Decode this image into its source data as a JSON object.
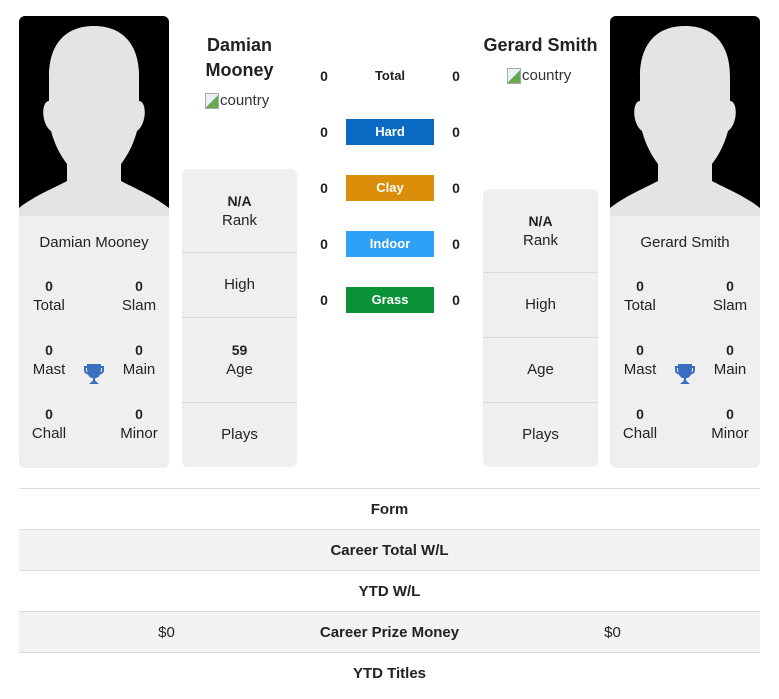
{
  "player1": {
    "name": "Damian Mooney",
    "name_line1": "Damian",
    "name_line2": "Mooney",
    "country_alt": "country",
    "titles": {
      "total": {
        "value": "0",
        "label": "Total"
      },
      "slam": {
        "value": "0",
        "label": "Slam"
      },
      "mast": {
        "value": "0",
        "label": "Mast"
      },
      "main": {
        "value": "0",
        "label": "Main"
      },
      "chall": {
        "value": "0",
        "label": "Chall"
      },
      "minor": {
        "value": "0",
        "label": "Minor"
      }
    },
    "info": {
      "rank_value": "N/A",
      "rank_label": "Rank",
      "high_label": "High",
      "age_value": "59",
      "age_label": "Age",
      "plays_label": "Plays"
    }
  },
  "player2": {
    "name": "Gerard Smith",
    "country_alt": "country",
    "titles": {
      "total": {
        "value": "0",
        "label": "Total"
      },
      "slam": {
        "value": "0",
        "label": "Slam"
      },
      "mast": {
        "value": "0",
        "label": "Mast"
      },
      "main": {
        "value": "0",
        "label": "Main"
      },
      "chall": {
        "value": "0",
        "label": "Chall"
      },
      "minor": {
        "value": "0",
        "label": "Minor"
      }
    },
    "info": {
      "rank_value": "N/A",
      "rank_label": "Rank",
      "high_label": "High",
      "age_label": "Age",
      "plays_label": "Plays"
    }
  },
  "surfaces": [
    {
      "label": "Total",
      "p1": "0",
      "p2": "0",
      "color": ""
    },
    {
      "label": "Hard",
      "p1": "0",
      "p2": "0",
      "color": "#0a6ac3"
    },
    {
      "label": "Clay",
      "p1": "0",
      "p2": "0",
      "color": "#db8e09"
    },
    {
      "label": "Indoor",
      "p1": "0",
      "p2": "0",
      "color": "#2ea0f6"
    },
    {
      "label": "Grass",
      "p1": "0",
      "p2": "0",
      "color": "#0a9236"
    }
  ],
  "stats": [
    {
      "label": "Form",
      "p1": "",
      "p2": ""
    },
    {
      "label": "Career Total W/L",
      "p1": "",
      "p2": ""
    },
    {
      "label": "YTD W/L",
      "p1": "",
      "p2": ""
    },
    {
      "label": "Career Prize Money",
      "p1": "$0",
      "p2": "$0"
    },
    {
      "label": "YTD Titles",
      "p1": "",
      "p2": ""
    }
  ],
  "icons": {
    "trophy_color": "#3a6fc0"
  }
}
